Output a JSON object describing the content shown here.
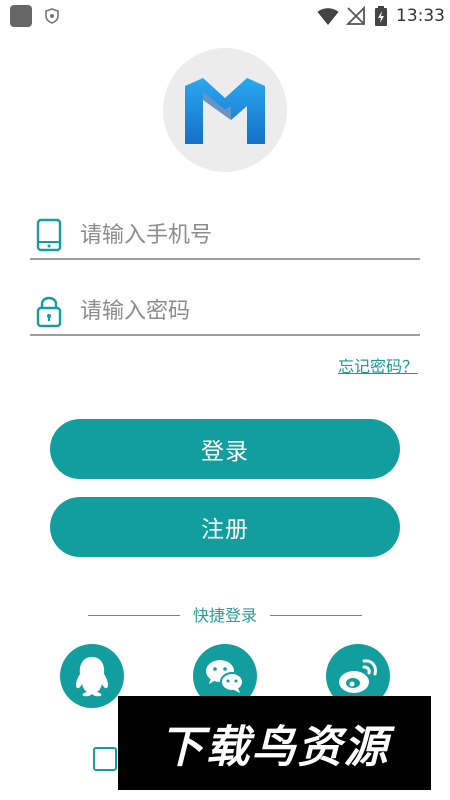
{
  "status_bar": {
    "time": "13:33",
    "icons": [
      "app-icon",
      "shield-icon",
      "wifi-icon",
      "no-signal-icon",
      "battery-charging-icon"
    ]
  },
  "logo": {
    "letter": "M",
    "icon": "m-logo-icon"
  },
  "phone_field": {
    "placeholder": "请输入手机号",
    "value": "",
    "icon": "phone-icon"
  },
  "password_field": {
    "placeholder": "请输入密码",
    "value": "",
    "icon": "lock-icon"
  },
  "forgot_password": "忘记密码？",
  "buttons": {
    "login": "登录",
    "register": "注册"
  },
  "quick_login": {
    "label": "快捷登录",
    "options": [
      "qq-icon",
      "wechat-icon",
      "weibo-icon"
    ]
  },
  "watermark": "下载鸟资源",
  "colors": {
    "accent": "#129e9e",
    "logo_blue": "#1e8fe0",
    "divider": "#9e9e9e"
  }
}
